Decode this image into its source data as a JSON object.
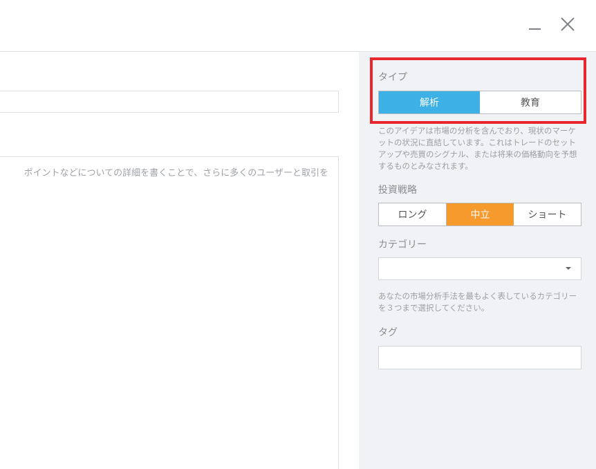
{
  "window": {
    "minimize_icon": "minimize-icon",
    "close_icon": "close-icon"
  },
  "main": {
    "description_placeholder": "ポイントなどについての詳細を書くことで、さらに多くのユーザーと取引を"
  },
  "sidebar": {
    "type": {
      "label": "タイプ",
      "options": [
        "解析",
        "教育"
      ],
      "selected": "解析",
      "description": "このアイデアは市場の分析を含んでおり、現状のマーケットの状況に直結しています。これはトレードのセットアップや売買のシグナル、または将来の価格動向を予想するものとみなされます。"
    },
    "strategy": {
      "label": "投資戦略",
      "options": [
        "ロング",
        "中立",
        "ショート"
      ],
      "selected": "中立"
    },
    "category": {
      "label": "カテゴリー",
      "value": "",
      "help": "あなたの市場分析手法を最もよく表しているカテゴリーを３つまで選択してください。"
    },
    "tags": {
      "label": "タグ",
      "value": ""
    }
  },
  "colors": {
    "highlight_border": "#e8262d",
    "type_active": "#3db0e5",
    "strategy_active": "#f79a2d",
    "sidebar_bg": "#f1f2f5"
  }
}
